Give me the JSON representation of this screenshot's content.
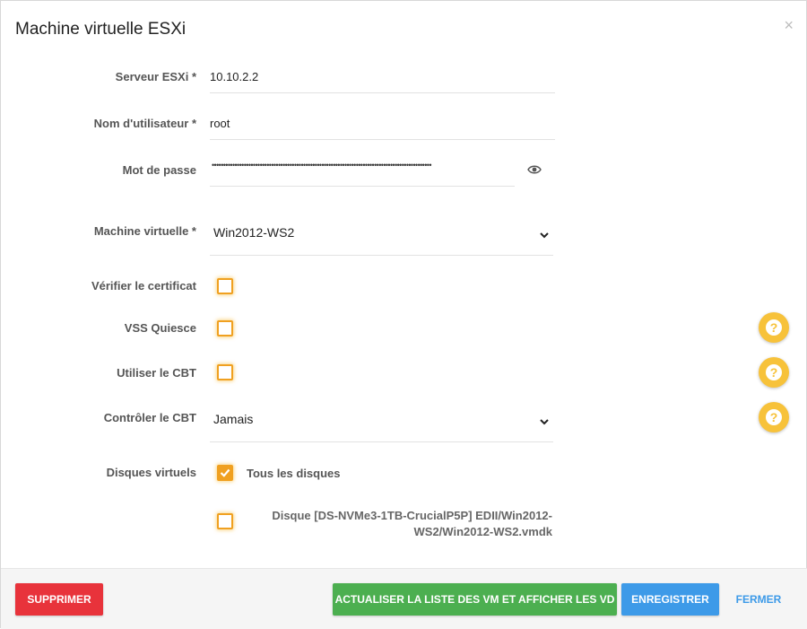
{
  "dialog": {
    "title": "Machine virtuelle ESXi",
    "close_glyph": "×"
  },
  "form": {
    "server": {
      "label": "Serveur ESXi *",
      "value": "10.10.2.2"
    },
    "username": {
      "label": "Nom d'utilisateur *",
      "value": "root"
    },
    "password": {
      "label": "Mot de passe",
      "masked_value": "••••••••••••••••••••••••••••••••••••••••••••••••••••••••••••••••••••••••••••••••••••••••••••••••",
      "icon": "eye-icon"
    },
    "vm": {
      "label": "Machine virtuelle *",
      "selected": "Win2012-WS2"
    },
    "verify_cert": {
      "label": "Vérifier le certificat",
      "checked": false
    },
    "vss_quiesce": {
      "label": "VSS Quiesce",
      "checked": false
    },
    "use_cbt": {
      "label": "Utiliser le CBT",
      "checked": false
    },
    "check_cbt": {
      "label": "Contrôler le CBT",
      "selected": "Jamais"
    },
    "disks": {
      "label": "Disques virtuels",
      "all": {
        "label": "Tous les disques",
        "checked": true
      },
      "disk1": {
        "label": "Disque [DS-NVMe3-1TB-CrucialP5P] EDII/Win2012-WS2/Win2012-WS2.vmdk",
        "checked": false
      }
    }
  },
  "help": {
    "glyph": "?",
    "icon": "help-icon"
  },
  "footer": {
    "delete": "SUPPRIMER",
    "refresh": "ACTUALISER LA LISTE DES VM ET AFFICHER LES VD",
    "save": "ENREGISTRER",
    "close": "FERMER"
  },
  "colors": {
    "accent_orange": "#f0a020",
    "help_yellow": "#f7c23a",
    "red": "#e8333b",
    "green": "#4caf50",
    "blue": "#3d9ae8"
  }
}
